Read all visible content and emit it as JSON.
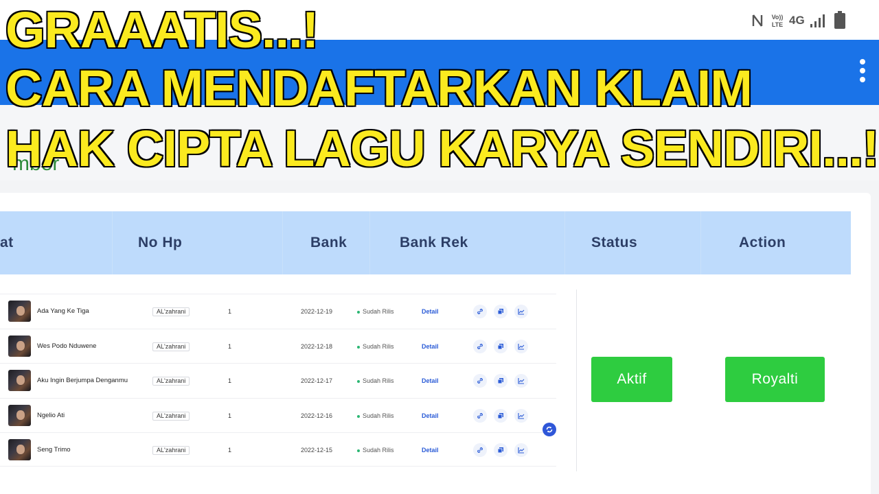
{
  "status_bar": {
    "network_label": "4G",
    "volte_label": "Vo)) LTE"
  },
  "headline": {
    "line1": "GRAAATIS...!",
    "line2": "CARA MENDAFTARKAN KLAIM",
    "line3": "HAK CIPTA LAGU KARYA SENDIRI...!"
  },
  "page": {
    "partial_heading": "mber"
  },
  "table_header": {
    "col_partial": "at",
    "no_hp": "No Hp",
    "bank": "Bank",
    "bank_rek": "Bank Rek",
    "status": "Status",
    "action": "Action"
  },
  "releases": [
    {
      "title": "Ada Yang Ke Tiga",
      "artist": "AL'zahrani",
      "qty": "1",
      "date": "2022-12-19",
      "status": "Sudah Rilis",
      "detail": "Detail"
    },
    {
      "title": "Wes Podo Nduwene",
      "artist": "AL'zahrani",
      "qty": "1",
      "date": "2022-12-18",
      "status": "Sudah Rilis",
      "detail": "Detail"
    },
    {
      "title": "Aku Ingin Berjumpa Denganmu",
      "artist": "AL'zahrani",
      "qty": "1",
      "date": "2022-12-17",
      "status": "Sudah Rilis",
      "detail": "Detail"
    },
    {
      "title": "Ngelio Ati",
      "artist": "AL'zahrani",
      "qty": "1",
      "date": "2022-12-16",
      "status": "Sudah Rilis",
      "detail": "Detail"
    },
    {
      "title": "Seng Trimo",
      "artist": "AL'zahrani",
      "qty": "1",
      "date": "2022-12-15",
      "status": "Sudah Rilis",
      "detail": "Detail"
    }
  ],
  "buttons": {
    "aktif": "Aktif",
    "royalti": "Royalti"
  },
  "colors": {
    "app_bar": "#1a73e8",
    "header_row": "#bedbfc",
    "button_green": "#2ecc40",
    "headline_yellow": "#fbea1f"
  },
  "icons": [
    "nfc-icon",
    "volte-icon",
    "signal-icon",
    "battery-icon",
    "more-vert-icon",
    "link-icon",
    "copy-icon",
    "chart-icon",
    "refresh-icon"
  ]
}
